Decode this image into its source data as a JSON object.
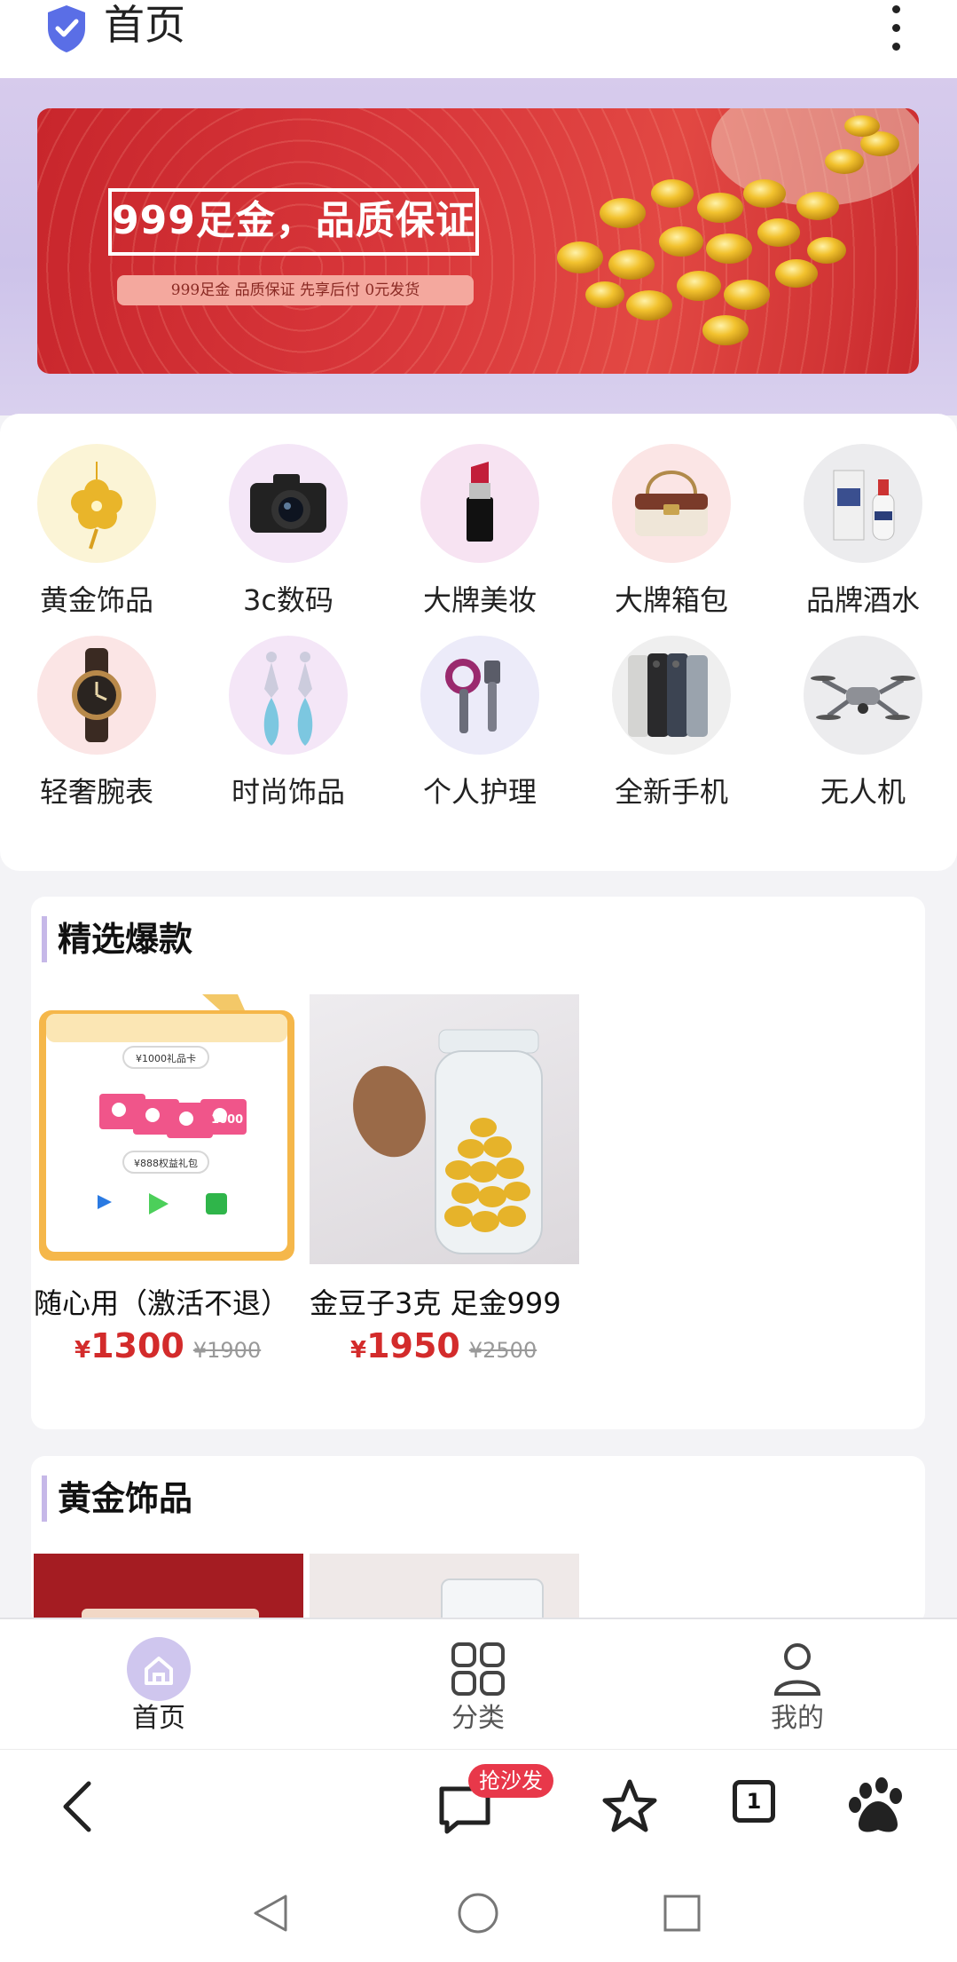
{
  "topbar": {
    "title": "首页",
    "icons": [
      "shield-check-icon",
      "more-vertical-icon"
    ]
  },
  "banner": {
    "headline": "999足金，品质保证",
    "subtag": "999足金 品质保证  先享后付 0元发货"
  },
  "categories": [
    {
      "label": "黄金饰品",
      "icon": "gold-flower-pendant"
    },
    {
      "label": "3c数码",
      "icon": "camera"
    },
    {
      "label": "大牌美妆",
      "icon": "lipstick"
    },
    {
      "label": "大牌箱包",
      "icon": "handbag"
    },
    {
      "label": "品牌酒水",
      "icon": "liquor-bottle"
    },
    {
      "label": "轻奢腕表",
      "icon": "wristwatch"
    },
    {
      "label": "时尚饰品",
      "icon": "earrings"
    },
    {
      "label": "个人护理",
      "icon": "hair-dryer"
    },
    {
      "label": "全新手机",
      "icon": "smartphones"
    },
    {
      "label": "无人机",
      "icon": "drone"
    }
  ],
  "sections": [
    {
      "title": "精选爆款",
      "products": [
        {
          "name": "随心用（激活不退）",
          "currency": "¥",
          "price": "1300",
          "old_price": "¥1900",
          "image_text": {
            "card": "¥1000礼品卡",
            "card_value": "1000",
            "pack": "¥888权益礼包"
          }
        },
        {
          "name": "金豆子3克 足金999",
          "currency": "¥",
          "price": "1950",
          "old_price": "¥2500"
        }
      ]
    },
    {
      "title": "黄金饰品",
      "products": []
    }
  ],
  "appnav": {
    "items": [
      {
        "label": "首页",
        "icon": "home-icon",
        "active": true
      },
      {
        "label": "分类",
        "icon": "grid-icon",
        "active": false
      },
      {
        "label": "我的",
        "icon": "user-icon",
        "active": false
      }
    ]
  },
  "browser": {
    "badge": "抢沙发",
    "tab_count": "1"
  },
  "colors": {
    "accent": "#6b5bd6",
    "price": "#d32b2b",
    "badge": "#e8384a",
    "nav_active_bg": "#cfc6ee"
  }
}
